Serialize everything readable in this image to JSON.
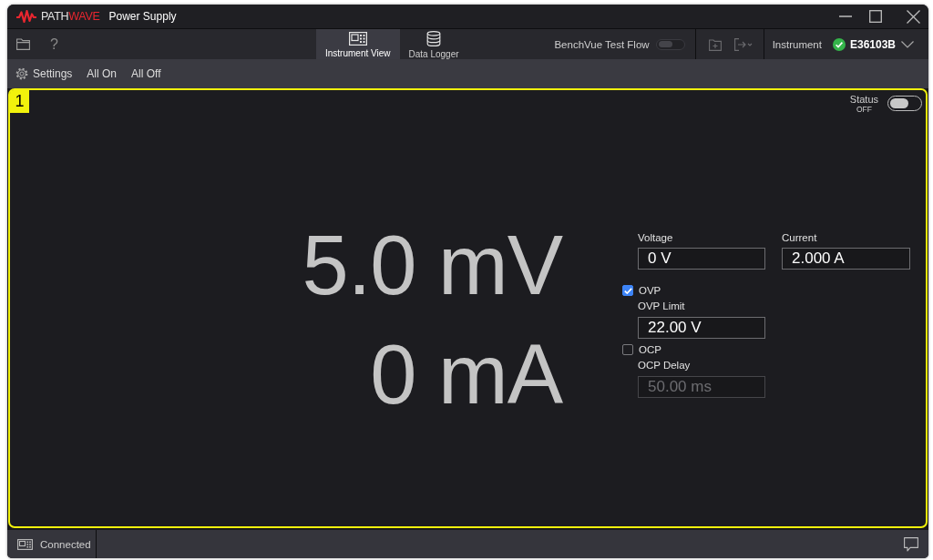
{
  "window": {
    "logo": {
      "text": "PATH",
      "accent": "WAVE"
    },
    "title": "Power Supply"
  },
  "toolbar": {
    "help": "?",
    "tabs": [
      {
        "label": "Instrument View",
        "kind": "instrument",
        "selected": true
      },
      {
        "label": "Data Logger",
        "kind": "database",
        "selected": false
      }
    ],
    "test_flow": {
      "label": "BenchVue Test Flow",
      "on": false
    },
    "instrument": {
      "label": "Instrument",
      "model": "E36103B",
      "connected": true
    }
  },
  "actions": [
    {
      "label": "Settings",
      "kind": "settings"
    },
    {
      "label": "All On",
      "kind": "plain"
    },
    {
      "label": "All Off",
      "kind": "plain"
    }
  ],
  "channel": {
    "number": "1",
    "status": {
      "label": "Status",
      "value": "OFF",
      "on": false
    },
    "readings": [
      "5.0 mV",
      "0 mA"
    ],
    "settings": {
      "voltage": {
        "label": "Voltage",
        "value": "0 V"
      },
      "current": {
        "label": "Current",
        "value": "2.000 A"
      },
      "ovp": {
        "label": "OVP",
        "checked": true,
        "field": {
          "label": "OVP Limit",
          "value": "22.00 V",
          "disabled": false
        }
      },
      "ocp": {
        "label": "OCP",
        "checked": false,
        "field": {
          "label": "OCP Delay",
          "value": "50.00 ms",
          "disabled": true
        }
      }
    }
  },
  "status_bar": {
    "connection": "Connected"
  }
}
